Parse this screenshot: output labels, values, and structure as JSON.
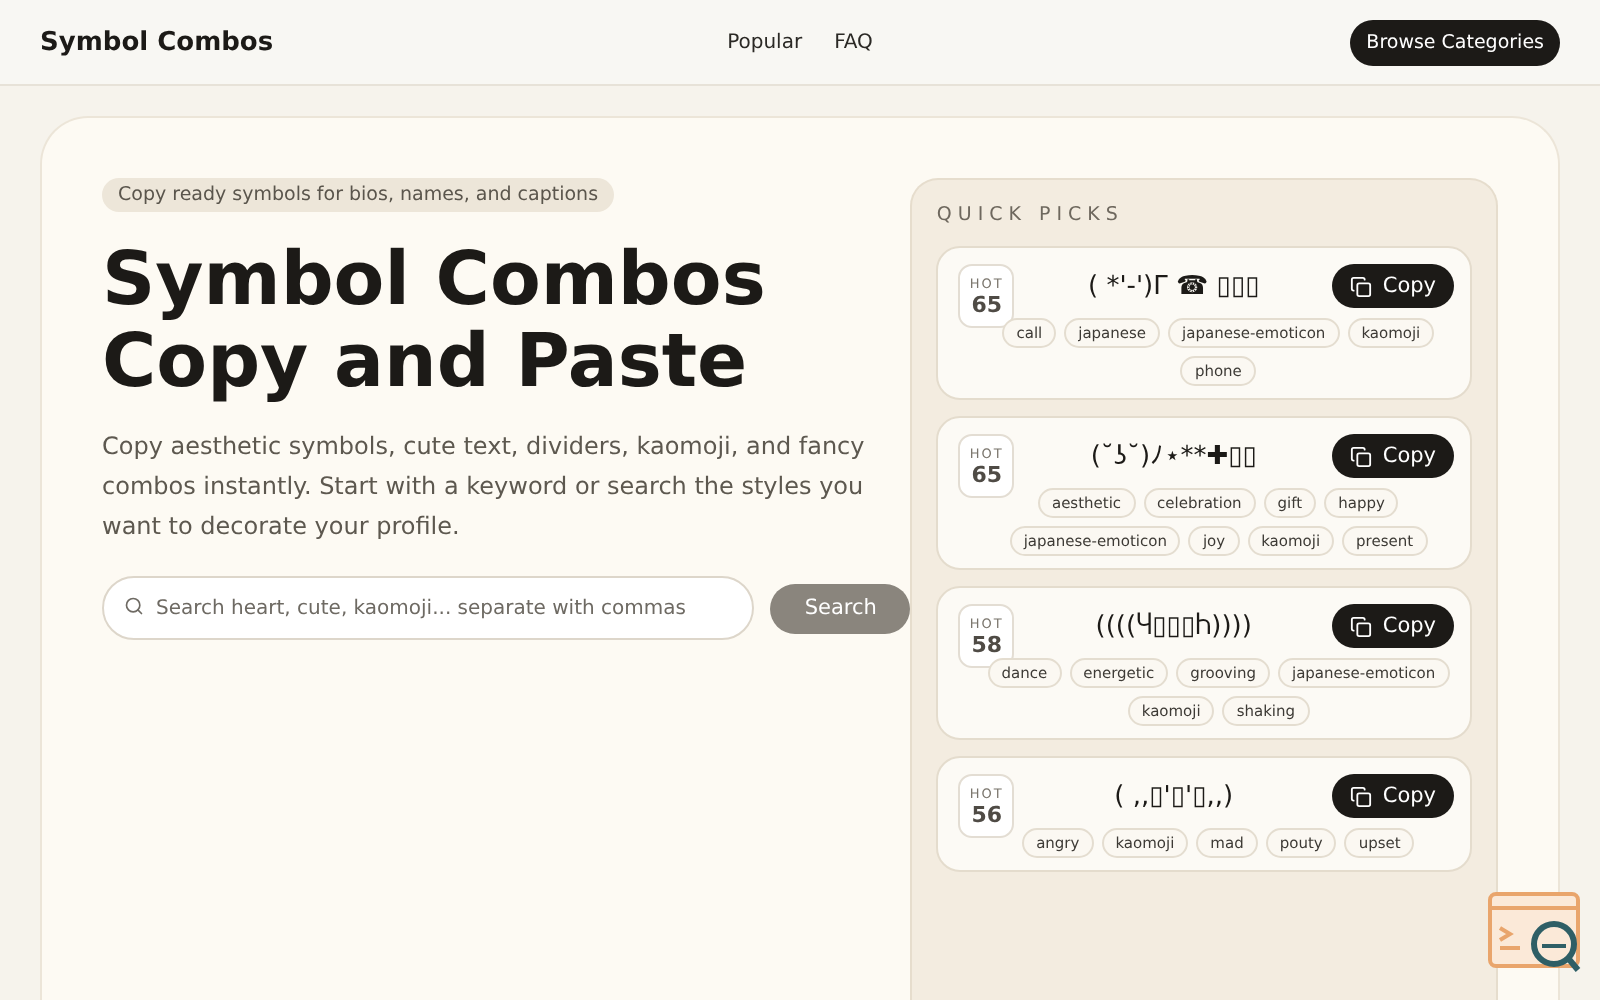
{
  "header": {
    "brand": "Symbol Combos",
    "nav": [
      "Popular",
      "FAQ"
    ],
    "cta": "Browse Categories"
  },
  "hero": {
    "badge": "Copy ready symbols for bios, names, and captions",
    "title_lines": [
      "Symbol Combos",
      "Copy and Paste"
    ],
    "description": "Copy aesthetic symbols, cute text, dividers, kaomoji, and fancy combos instantly. Start with a keyword or search the styles you want to decorate your profile.",
    "search": {
      "placeholder": "Search heart, cute, kaomoji... separate with commas",
      "button": "Search"
    }
  },
  "quick_picks": {
    "title": "QUICK PICKS",
    "items": [
      {
        "hot_label": "HOT",
        "hot": "65",
        "symbol": "( *'-')Γ ☎ ▯▯▯",
        "copy": "Copy",
        "tags": [
          "call",
          "japanese",
          "japanese-emoticon",
          "kaomoji",
          "phone"
        ]
      },
      {
        "hot_label": "HOT",
        "hot": "65",
        "symbol": "(˘ʖ˘)ﾉ⋆**✚▯▯",
        "copy": "Copy",
        "tags": [
          "aesthetic",
          "celebration",
          "gift",
          "happy",
          "japanese-emoticon",
          "joy",
          "kaomoji",
          "present"
        ]
      },
      {
        "hot_label": "HOT",
        "hot": "58",
        "symbol": "((((Ⴗ▯▯▯Ⴙ))))",
        "copy": "Copy",
        "tags": [
          "dance",
          "energetic",
          "grooving",
          "japanese-emoticon",
          "kaomoji",
          "shaking"
        ]
      },
      {
        "hot_label": "HOT",
        "hot": "56",
        "symbol": "( ,,▯'▯'▯,,)",
        "copy": "Copy",
        "tags": [
          "angry",
          "kaomoji",
          "mad",
          "pouty",
          "upset"
        ]
      }
    ]
  }
}
